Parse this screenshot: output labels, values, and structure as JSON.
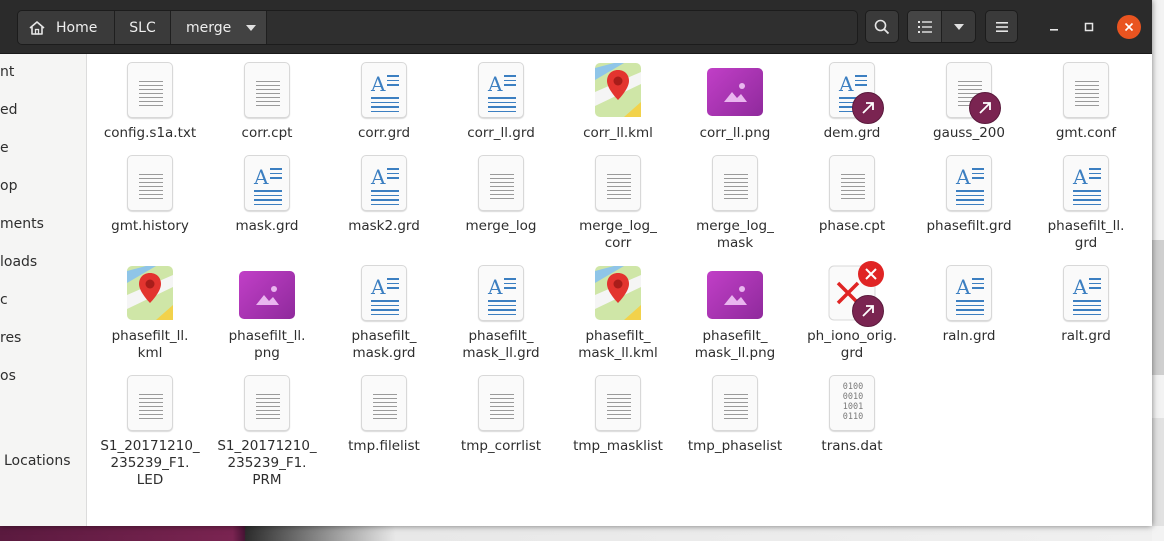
{
  "window": {
    "path": [
      {
        "label": "Home",
        "icon": "home-icon"
      },
      {
        "label": "SLC"
      },
      {
        "label": "merge",
        "icon": "chevron-down-icon"
      }
    ],
    "toolbar_icons": [
      "search-icon",
      "list-view-icon",
      "chevron-down-icon",
      "hamburger-menu-icon"
    ],
    "window_controls": [
      "minimize-icon",
      "maximize-icon",
      "close-icon"
    ]
  },
  "sidebar": {
    "items": [
      {
        "label": "nt"
      },
      {
        "label": "ed"
      },
      {
        "label": "e"
      },
      {
        "label": "op"
      },
      {
        "label": "ments"
      },
      {
        "label": "loads"
      },
      {
        "label": "c"
      },
      {
        "label": "res"
      },
      {
        "label": "os"
      },
      {
        "label": "Locations"
      }
    ]
  },
  "files": [
    {
      "name": "config.s1a.txt",
      "type": "text"
    },
    {
      "name": "corr.cpt",
      "type": "text"
    },
    {
      "name": "corr.grd",
      "type": "rich"
    },
    {
      "name": "corr_ll.grd",
      "type": "rich"
    },
    {
      "name": "corr_ll.kml",
      "type": "map"
    },
    {
      "name": "corr_ll.png",
      "type": "image"
    },
    {
      "name": "dem.grd",
      "type": "rich",
      "link": true
    },
    {
      "name": "gauss_200",
      "type": "text",
      "link": true
    },
    {
      "name": "gmt.conf",
      "type": "text"
    },
    {
      "name": "gmt.history",
      "type": "text"
    },
    {
      "name": "mask.grd",
      "type": "rich"
    },
    {
      "name": "mask2.grd",
      "type": "rich"
    },
    {
      "name": "merge_log",
      "type": "text"
    },
    {
      "name": "merge_log_\ncorr",
      "type": "text"
    },
    {
      "name": "merge_log_\nmask",
      "type": "text"
    },
    {
      "name": "phase.cpt",
      "type": "text"
    },
    {
      "name": "phasefilt.grd",
      "type": "rich"
    },
    {
      "name": "phasefilt_ll.\ngrd",
      "type": "rich"
    },
    {
      "name": "phasefilt_ll.\nkml",
      "type": "map"
    },
    {
      "name": "phasefilt_ll.\npng",
      "type": "image"
    },
    {
      "name": "phasefilt_\nmask.grd",
      "type": "rich"
    },
    {
      "name": "phasefilt_\nmask_ll.grd",
      "type": "rich"
    },
    {
      "name": "phasefilt_\nmask_ll.kml",
      "type": "map"
    },
    {
      "name": "phasefilt_\nmask_ll.png",
      "type": "image"
    },
    {
      "name": "ph_iono_orig.\ngrd",
      "type": "broken",
      "link": true
    },
    {
      "name": "raln.grd",
      "type": "rich"
    },
    {
      "name": "ralt.grd",
      "type": "rich"
    },
    {
      "name": "S1_20171210_\n235239_F1.\nLED",
      "type": "text"
    },
    {
      "name": "S1_20171210_\n235239_F1.\nPRM",
      "type": "text"
    },
    {
      "name": "tmp.filelist",
      "type": "text"
    },
    {
      "name": "tmp_corrlist",
      "type": "text"
    },
    {
      "name": "tmp_masklist",
      "type": "text"
    },
    {
      "name": "tmp_phaselist",
      "type": "text"
    },
    {
      "name": "trans.dat",
      "type": "binary",
      "glyph": "0100\n0010\n1001\n0110"
    }
  ],
  "colors": {
    "headerbar": "#2b2b2b",
    "close_button": "#e95420",
    "link_emblem": "#7a2451",
    "doc_blue": "#3c7fc1",
    "image_purple": "#b03ab8"
  }
}
